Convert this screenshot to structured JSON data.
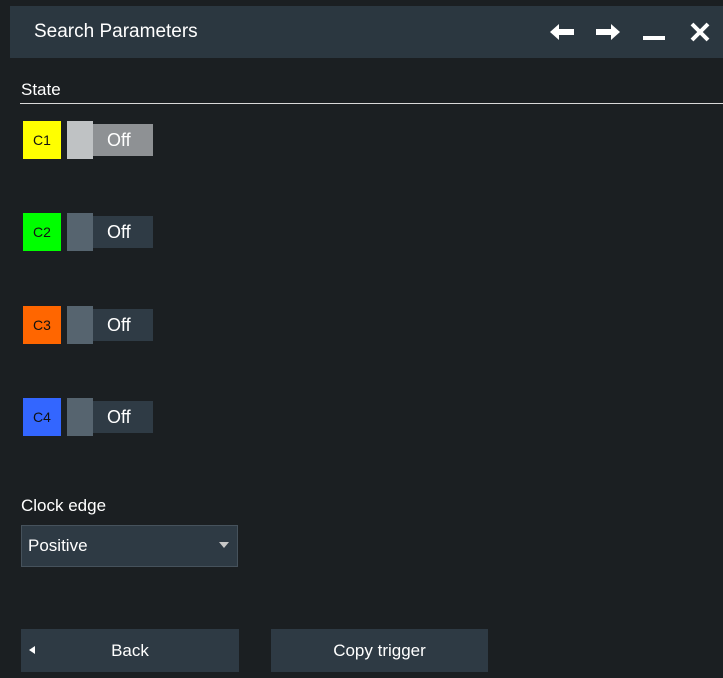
{
  "window": {
    "title": "Search Parameters",
    "icons": [
      "arrow-left-icon",
      "arrow-right-icon",
      "minimize-icon",
      "close-icon"
    ]
  },
  "state": {
    "label": "State",
    "channels": [
      {
        "badge": "C1",
        "color": "#ffff00",
        "toggle": "Off",
        "focused": true
      },
      {
        "badge": "C2",
        "color": "#00ff00",
        "toggle": "Off",
        "focused": false
      },
      {
        "badge": "C3",
        "color": "#ff6600",
        "toggle": "Off",
        "focused": false
      },
      {
        "badge": "C4",
        "color": "#3366ff",
        "toggle": "Off",
        "focused": false
      }
    ]
  },
  "clock_edge": {
    "label": "Clock edge",
    "value": "Positive"
  },
  "buttons": {
    "back": "Back",
    "copy_trigger": "Copy trigger"
  },
  "colors": {
    "titlebar": "#2b3740",
    "background": "#1b1f22",
    "control": "#2e3a44"
  }
}
